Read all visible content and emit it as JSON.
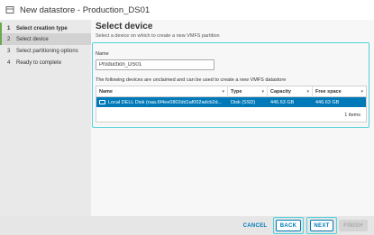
{
  "dialog": {
    "title": "New datastore - Production_DS01"
  },
  "sidebar": {
    "steps": [
      {
        "num": "1",
        "label": "Select creation type"
      },
      {
        "num": "2",
        "label": "Select device"
      },
      {
        "num": "3",
        "label": "Select partitioning options"
      },
      {
        "num": "4",
        "label": "Ready to complete"
      }
    ]
  },
  "main": {
    "title": "Select device",
    "subtitle": "Select a device on which to create a new VMFS partition",
    "name_label": "Name",
    "name_value": "Production_DS01",
    "devices_note": "The following devices are unclaimed and can be used to create a new VMFS datastore"
  },
  "table": {
    "columns": [
      "Name",
      "Type",
      "Capacity",
      "Free space"
    ],
    "rows": [
      {
        "name": "Local DELL Disk (naa.6f4ee0802dd1af002adcb2d...",
        "type": "Disk (SSD)",
        "capacity": "446.63 GB",
        "free": "446.63 GB"
      }
    ],
    "footer": "1 items"
  },
  "buttons": {
    "cancel": "CANCEL",
    "back": "BACK",
    "next": "NEXT",
    "finish": "FINISH"
  }
}
